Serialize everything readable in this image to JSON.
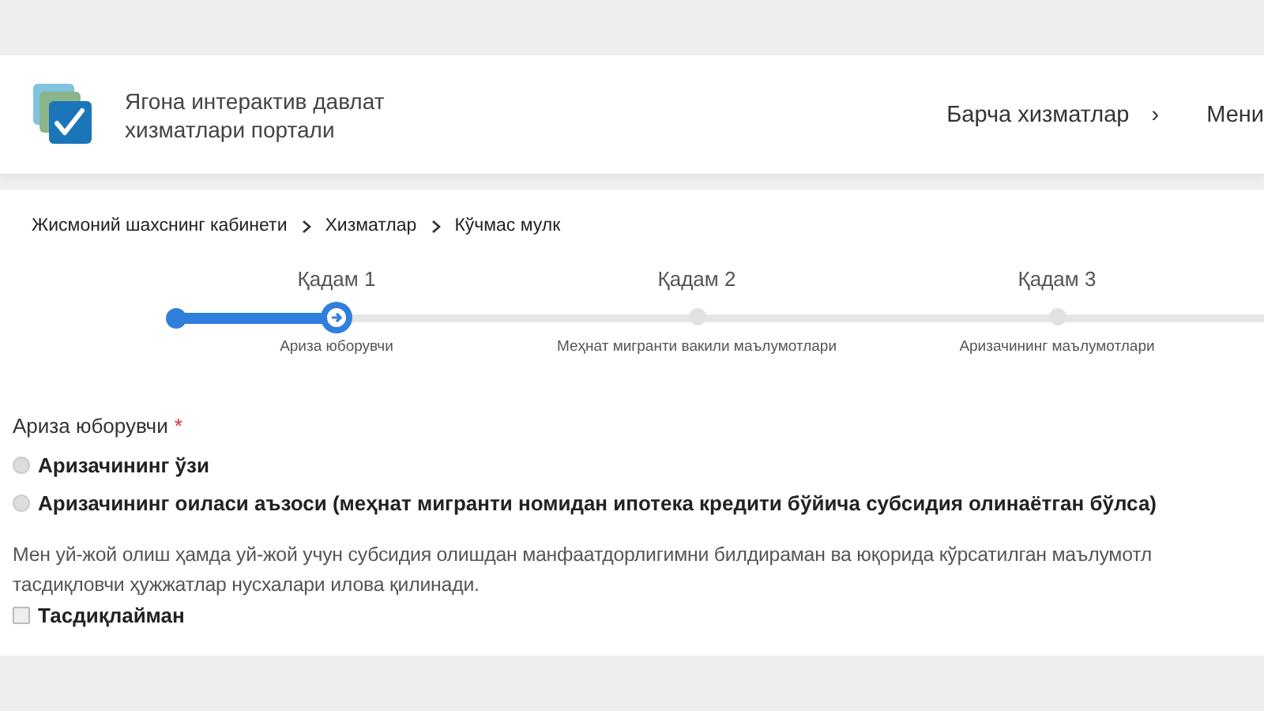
{
  "header": {
    "logo_title_lines": [
      "Ягона интерактив давлат",
      "хизматлари портали"
    ],
    "nav": [
      {
        "label": "Барча хизматлар",
        "arrow": "›"
      },
      {
        "label": "Мени"
      }
    ]
  },
  "breadcrumbs": [
    {
      "label": "Жисмоний шахснинг кабинети"
    },
    {
      "label": "Хизматлар"
    },
    {
      "label": "Кўчмас мулк"
    }
  ],
  "steps": [
    {
      "title": "Қадам 1",
      "caption": "Ариза юборувчи",
      "selected": true
    },
    {
      "title": "Қадам 2",
      "caption": "Меҳнат мигранти вакили маълумотлари",
      "selected": false
    },
    {
      "title": "Қадам 3",
      "caption": "Аризачининг маълумотлари",
      "selected": false
    }
  ],
  "form": {
    "label": "Ариза юборувчи",
    "required_mark": "*",
    "options": [
      {
        "label": "Аризачининг ўзи",
        "selected": false
      },
      {
        "label": "Аризачининг оиласи аъзоси (меҳнат мигранти номидан ипотека кредити бўйича субсидия олинаётган бўлса)",
        "selected": false
      }
    ],
    "statement_lines": [
      "Мен уй-жой олиш ҳамда уй-жой учун субсидия олишдан манфаатдорлигимни билдираман ва юқорида кўрсатилган маълумотл",
      "тасдиқловчи ҳужжатлар нусхалари илова қилинади."
    ],
    "confirm": {
      "label": "Тасдиқлайман",
      "checked": false
    }
  }
}
